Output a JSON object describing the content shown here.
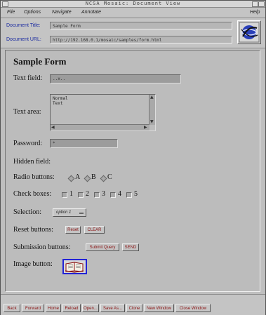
{
  "window": {
    "title": "NCSA Mosaic: Document View"
  },
  "menu": {
    "file": "File",
    "options": "Options",
    "navigate": "Navigate",
    "annotate": "Annotate",
    "help": "Help"
  },
  "info": {
    "title_label": "Document Title:",
    "title_value": "Sample Form",
    "url_label": "Document URL:",
    "url_value": "http://192.168.0.1/mosaic/samples/form.html"
  },
  "form": {
    "heading": "Sample Form",
    "text_field_label": "Text field:",
    "text_field_value": "..x..",
    "text_area_label": "Text area:",
    "text_area_lines": [
      "Normal",
      "Text"
    ],
    "password_label": "Password:",
    "password_value": "*",
    "hidden_label": "Hidden field:",
    "radio_label": "Radio buttons:",
    "radio_options": [
      "A",
      "B",
      "C"
    ],
    "checkbox_label": "Check boxes:",
    "checkbox_options": [
      "1",
      "2",
      "3",
      "4",
      "5"
    ],
    "selection_label": "Selection:",
    "selection_value": "option 1",
    "reset_label": "Reset buttons:",
    "reset_btn1": "Reset",
    "reset_btn2": "CLEAR",
    "submit_label": "Submission buttons:",
    "submit_btn1": "Submit Query",
    "submit_btn2": "SEND",
    "image_label": "Image button:"
  },
  "bottom": {
    "back": "Back",
    "forward": "Forward",
    "home": "Home",
    "reload": "Reload",
    "open": "Open...",
    "save_as": "Save As...",
    "clone": "Clone",
    "new_window": "New Window",
    "close_window": "Close Window"
  }
}
